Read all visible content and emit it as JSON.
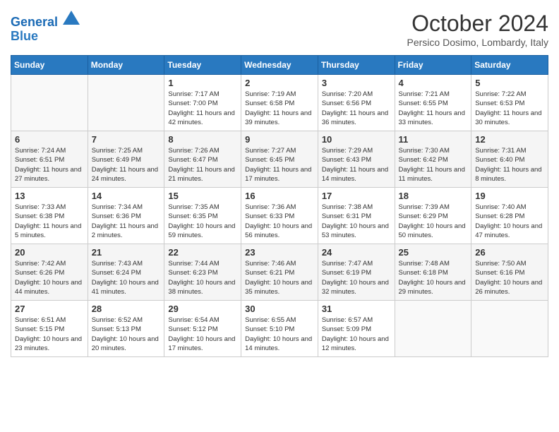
{
  "header": {
    "logo_line1": "General",
    "logo_line2": "Blue",
    "month_title": "October 2024",
    "subtitle": "Persico Dosimo, Lombardy, Italy"
  },
  "days_of_week": [
    "Sunday",
    "Monday",
    "Tuesday",
    "Wednesday",
    "Thursday",
    "Friday",
    "Saturday"
  ],
  "weeks": [
    [
      {
        "day": "",
        "info": ""
      },
      {
        "day": "",
        "info": ""
      },
      {
        "day": "1",
        "info": "Sunrise: 7:17 AM\nSunset: 7:00 PM\nDaylight: 11 hours and 42 minutes."
      },
      {
        "day": "2",
        "info": "Sunrise: 7:19 AM\nSunset: 6:58 PM\nDaylight: 11 hours and 39 minutes."
      },
      {
        "day": "3",
        "info": "Sunrise: 7:20 AM\nSunset: 6:56 PM\nDaylight: 11 hours and 36 minutes."
      },
      {
        "day": "4",
        "info": "Sunrise: 7:21 AM\nSunset: 6:55 PM\nDaylight: 11 hours and 33 minutes."
      },
      {
        "day": "5",
        "info": "Sunrise: 7:22 AM\nSunset: 6:53 PM\nDaylight: 11 hours and 30 minutes."
      }
    ],
    [
      {
        "day": "6",
        "info": "Sunrise: 7:24 AM\nSunset: 6:51 PM\nDaylight: 11 hours and 27 minutes."
      },
      {
        "day": "7",
        "info": "Sunrise: 7:25 AM\nSunset: 6:49 PM\nDaylight: 11 hours and 24 minutes."
      },
      {
        "day": "8",
        "info": "Sunrise: 7:26 AM\nSunset: 6:47 PM\nDaylight: 11 hours and 21 minutes."
      },
      {
        "day": "9",
        "info": "Sunrise: 7:27 AM\nSunset: 6:45 PM\nDaylight: 11 hours and 17 minutes."
      },
      {
        "day": "10",
        "info": "Sunrise: 7:29 AM\nSunset: 6:43 PM\nDaylight: 11 hours and 14 minutes."
      },
      {
        "day": "11",
        "info": "Sunrise: 7:30 AM\nSunset: 6:42 PM\nDaylight: 11 hours and 11 minutes."
      },
      {
        "day": "12",
        "info": "Sunrise: 7:31 AM\nSunset: 6:40 PM\nDaylight: 11 hours and 8 minutes."
      }
    ],
    [
      {
        "day": "13",
        "info": "Sunrise: 7:33 AM\nSunset: 6:38 PM\nDaylight: 11 hours and 5 minutes."
      },
      {
        "day": "14",
        "info": "Sunrise: 7:34 AM\nSunset: 6:36 PM\nDaylight: 11 hours and 2 minutes."
      },
      {
        "day": "15",
        "info": "Sunrise: 7:35 AM\nSunset: 6:35 PM\nDaylight: 10 hours and 59 minutes."
      },
      {
        "day": "16",
        "info": "Sunrise: 7:36 AM\nSunset: 6:33 PM\nDaylight: 10 hours and 56 minutes."
      },
      {
        "day": "17",
        "info": "Sunrise: 7:38 AM\nSunset: 6:31 PM\nDaylight: 10 hours and 53 minutes."
      },
      {
        "day": "18",
        "info": "Sunrise: 7:39 AM\nSunset: 6:29 PM\nDaylight: 10 hours and 50 minutes."
      },
      {
        "day": "19",
        "info": "Sunrise: 7:40 AM\nSunset: 6:28 PM\nDaylight: 10 hours and 47 minutes."
      }
    ],
    [
      {
        "day": "20",
        "info": "Sunrise: 7:42 AM\nSunset: 6:26 PM\nDaylight: 10 hours and 44 minutes."
      },
      {
        "day": "21",
        "info": "Sunrise: 7:43 AM\nSunset: 6:24 PM\nDaylight: 10 hours and 41 minutes."
      },
      {
        "day": "22",
        "info": "Sunrise: 7:44 AM\nSunset: 6:23 PM\nDaylight: 10 hours and 38 minutes."
      },
      {
        "day": "23",
        "info": "Sunrise: 7:46 AM\nSunset: 6:21 PM\nDaylight: 10 hours and 35 minutes."
      },
      {
        "day": "24",
        "info": "Sunrise: 7:47 AM\nSunset: 6:19 PM\nDaylight: 10 hours and 32 minutes."
      },
      {
        "day": "25",
        "info": "Sunrise: 7:48 AM\nSunset: 6:18 PM\nDaylight: 10 hours and 29 minutes."
      },
      {
        "day": "26",
        "info": "Sunrise: 7:50 AM\nSunset: 6:16 PM\nDaylight: 10 hours and 26 minutes."
      }
    ],
    [
      {
        "day": "27",
        "info": "Sunrise: 6:51 AM\nSunset: 5:15 PM\nDaylight: 10 hours and 23 minutes."
      },
      {
        "day": "28",
        "info": "Sunrise: 6:52 AM\nSunset: 5:13 PM\nDaylight: 10 hours and 20 minutes."
      },
      {
        "day": "29",
        "info": "Sunrise: 6:54 AM\nSunset: 5:12 PM\nDaylight: 10 hours and 17 minutes."
      },
      {
        "day": "30",
        "info": "Sunrise: 6:55 AM\nSunset: 5:10 PM\nDaylight: 10 hours and 14 minutes."
      },
      {
        "day": "31",
        "info": "Sunrise: 6:57 AM\nSunset: 5:09 PM\nDaylight: 10 hours and 12 minutes."
      },
      {
        "day": "",
        "info": ""
      },
      {
        "day": "",
        "info": ""
      }
    ]
  ]
}
